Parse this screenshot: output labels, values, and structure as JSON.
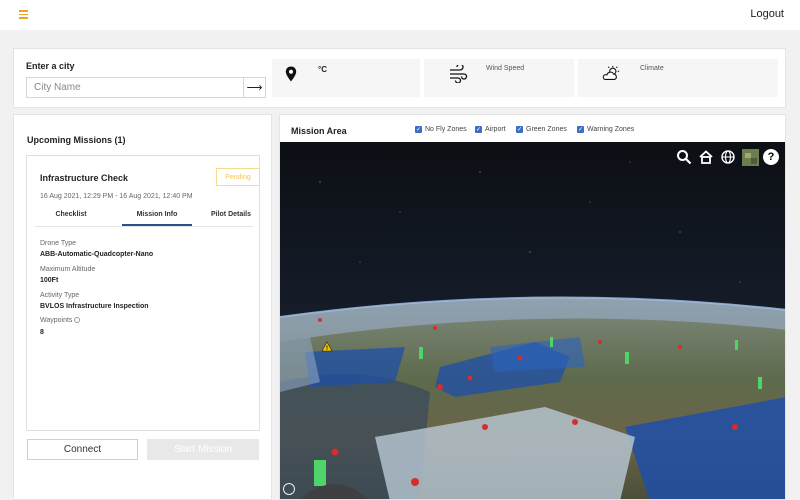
{
  "header": {
    "menu_icon": "hamburger-icon",
    "logout_label": "Logout"
  },
  "city_search": {
    "label": "Enter a city",
    "placeholder": "City Name",
    "submit_icon": "arrow-right-icon"
  },
  "weather": {
    "temperature_unit": "°C",
    "wind_label": "Wind Speed",
    "climate_label": "Climate",
    "icons": [
      "location-pin-icon",
      "wind-icon",
      "partly-cloudy-icon"
    ]
  },
  "missions": {
    "title": "Upcoming Missions (1)",
    "card": {
      "name": "Infrastructure Check",
      "status": "Pending",
      "time_range": "16 Aug 2021, 12:29 PM - 16 Aug 2021, 12:40 PM",
      "tabs": [
        "Checklist",
        "Mission Info",
        "Pilot Details"
      ],
      "active_tab": "Mission Info",
      "fields": [
        {
          "label": "Drone Type",
          "value": "ABB-Automatic-Quadcopter-Nano"
        },
        {
          "label": "Maximum Altitude",
          "value": "100Ft"
        },
        {
          "label": "Activity Type",
          "value": "BVLOS Infrastructure Inspection"
        },
        {
          "label": "Waypoints",
          "value": "8"
        }
      ]
    },
    "connect_label": "Connect",
    "start_label": "Start Mission"
  },
  "map": {
    "title": "Mission Area",
    "filters": [
      {
        "label": "No Fly Zones",
        "checked": true
      },
      {
        "label": "Airport",
        "checked": true
      },
      {
        "label": "Green Zones",
        "checked": true
      },
      {
        "label": "Warning Zones",
        "checked": true
      }
    ],
    "tools": [
      "search-icon",
      "home-icon",
      "globe-icon",
      "imagery-layer-icon",
      "help-icon"
    ],
    "help_glyph": "?",
    "colors": {
      "no_fly_zone": "#1e4fa8",
      "green_zone": "#4fd46a",
      "airport": "#d92b2b",
      "warning": "#f4c400",
      "accent": "#3b6fc6",
      "menu_accent": "#f0a12b"
    }
  }
}
